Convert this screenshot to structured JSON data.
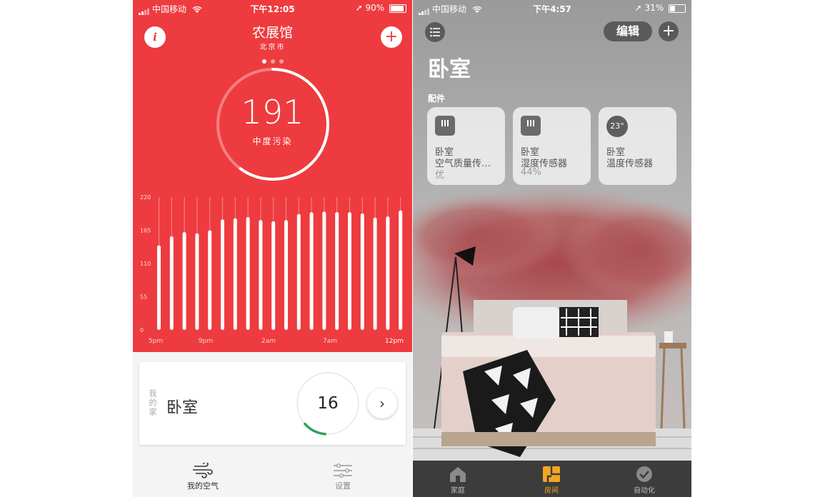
{
  "left": {
    "status": {
      "carrier": "中国移动",
      "time": "下午12:05",
      "battery": "90%"
    },
    "station": {
      "name": "农展馆",
      "city": "北京市",
      "page_count": 3,
      "active_page": 0
    },
    "aqi": {
      "value": "191",
      "label": "中度污染",
      "gauge_fraction": 0.6
    },
    "chart_data": {
      "type": "bar",
      "y_ticks": [
        "220",
        "165",
        "110",
        "55",
        "0"
      ],
      "ylim": [
        0,
        220
      ],
      "x_ticks": [
        "5pm",
        "9pm",
        "2am",
        "7am",
        "12pm"
      ],
      "values": [
        140,
        155,
        162,
        160,
        165,
        183,
        185,
        187,
        182,
        180,
        182,
        192,
        195,
        196,
        195,
        195,
        193,
        186,
        188,
        198
      ],
      "total_slots": 19
    },
    "card": {
      "vertical_label": "我的家",
      "room": "卧室",
      "value": "16",
      "ring_fraction": 0.12
    },
    "tabs": [
      {
        "label": "我的空气"
      },
      {
        "label": "设置"
      }
    ],
    "colors": {
      "accent": "#ee3b3f",
      "good": "#27a557"
    }
  },
  "right": {
    "status": {
      "carrier": "中国移动",
      "time": "下午4:57",
      "battery": "31%"
    },
    "header": {
      "edit": "编辑",
      "add": "+"
    },
    "room_title": "卧室",
    "section": "配件",
    "tiles": [
      {
        "icon": "air-quality-sensor-icon",
        "line1": "卧室",
        "line2": "空气质量传…",
        "line3": "优"
      },
      {
        "icon": "humidity-sensor-icon",
        "line1": "卧室",
        "line2": "湿度传感器",
        "line3": "44%"
      },
      {
        "icon": "temperature-badge",
        "badge": "23°",
        "line1": "卧室",
        "line2": "温度传感器",
        "line3": ""
      }
    ],
    "tabs": [
      {
        "label": "家庭"
      },
      {
        "label": "房间"
      },
      {
        "label": "自动化"
      }
    ],
    "colors": {
      "tab_active": "#f4a620"
    }
  }
}
